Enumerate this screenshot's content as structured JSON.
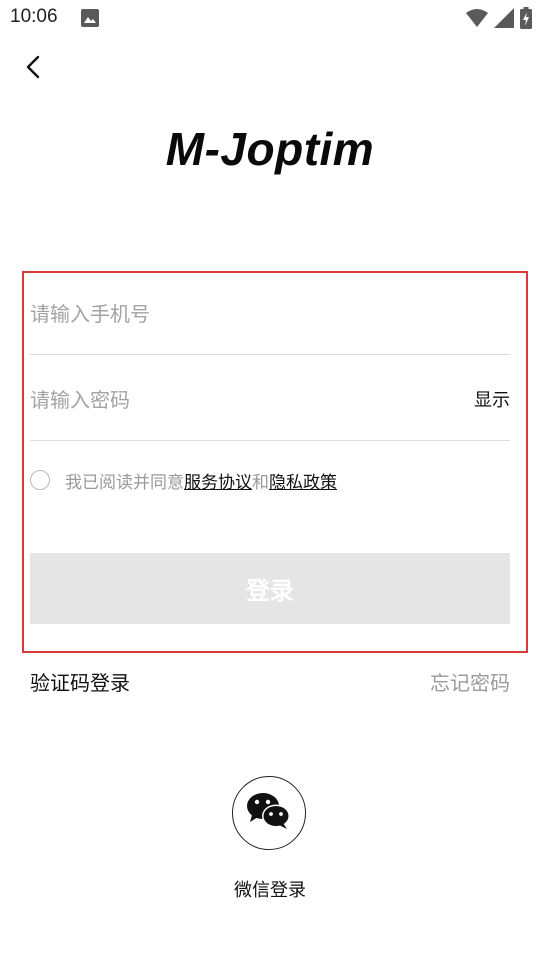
{
  "status_bar": {
    "time": "10:06"
  },
  "app": {
    "logo_text": "M-Joptim"
  },
  "form": {
    "phone_placeholder": "请输入手机号",
    "password_placeholder": "请输入密码",
    "show_password_label": "显示",
    "agree_prefix": "我已阅读并同意",
    "service_agreement": "服务协议",
    "agree_and": "和",
    "privacy_policy": "隐私政策",
    "login_label": "登录"
  },
  "links": {
    "sms_login": "验证码登录",
    "forgot_password": "忘记密码"
  },
  "wechat": {
    "label": "微信登录"
  },
  "colors": {
    "highlight_border": "#d93a3a",
    "login_button_bg": "#e5e5e5",
    "placeholder": "#a3a3a3"
  },
  "icons": [
    "image-icon",
    "wifi-icon",
    "signal-icon",
    "battery-charging-icon",
    "back-arrow-icon",
    "wechat-icon"
  ]
}
